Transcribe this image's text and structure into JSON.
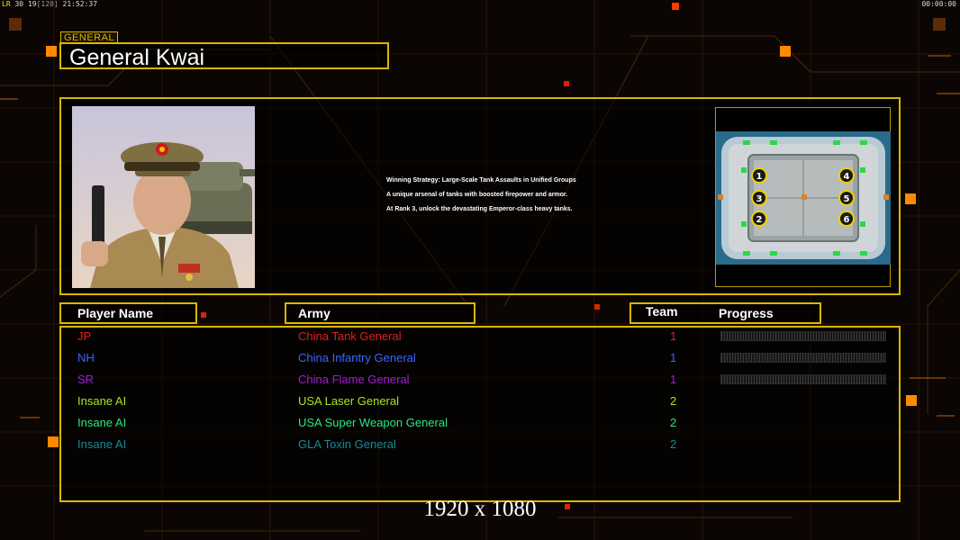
{
  "status_bar": {
    "fps_label": "LR",
    "fps_value": "30",
    "frame": "19",
    "frame_max": "[120]",
    "clock": "21:52:37",
    "timer": "00:00:00"
  },
  "general": {
    "tag": "GENERAL",
    "name": "General Kwai",
    "strategy": [
      "Winning Strategy: Large-Scale Tank Assaults in Unified Groups",
      "A unique arsenal of tanks with boosted firepower and armor.",
      "At Rank 3, unlock the devastating Emperor-class heavy tanks."
    ]
  },
  "map": {
    "slots": [
      "1",
      "2",
      "3",
      "4",
      "5",
      "6"
    ]
  },
  "columns": {
    "player": "Player Name",
    "army": "Army",
    "team": "Team",
    "progress": "Progress"
  },
  "players": [
    {
      "name": "JP",
      "army": "China Tank General",
      "team": "1",
      "color": "#e81c1c",
      "progress": true
    },
    {
      "name": "NH",
      "army": "China Infantry General",
      "team": "1",
      "color": "#3a66ff",
      "progress": true
    },
    {
      "name": "SR",
      "army": "China Flame General",
      "team": "1",
      "color": "#a21cd6",
      "progress": true
    },
    {
      "name": "Insane AI",
      "army": "USA Laser General",
      "team": "2",
      "color": "#a8e81a",
      "progress": false
    },
    {
      "name": "Insane AI",
      "army": "USA Super Weapon General",
      "team": "2",
      "color": "#28e884",
      "progress": false
    },
    {
      "name": "Insane AI",
      "army": "GLA Toxin General",
      "team": "2",
      "color": "#168a9a",
      "progress": false
    }
  ],
  "footer": {
    "resolution": "1920 x 1080"
  },
  "colors": {
    "accent_gold": "#d8b800",
    "accent_orange": "#ff8a00",
    "background": "#0b0604"
  }
}
